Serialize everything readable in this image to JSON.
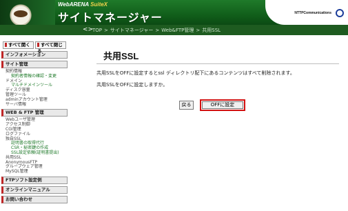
{
  "header": {
    "brand": "WebARENA",
    "suite": "SuiteX",
    "title": "サイトマネージャー",
    "company": "NTTPCommunications"
  },
  "breadcrumb": {
    "arrows": "<>",
    "items": [
      "TOP",
      "サイトマネージャー",
      "Web&FTP管理",
      "共用SSL"
    ]
  },
  "sidebar": {
    "open_all": "すべて開く",
    "close_all": "すべて閉じる",
    "info": "インフォメーション",
    "site_admin": "サイト管理",
    "site_items": [
      "契約情報",
      "契約者情報の確認・変更",
      "ドメイン",
      "マルチドメインツール",
      "ディスク容量",
      "管理ツール",
      "adminアカウント管理",
      "サーバ情報"
    ],
    "webftp": "WEB & FTP 管理",
    "webftp_items": [
      "Webユーザ管理",
      "アクセス制御",
      "CGI管理",
      "ログファイル",
      "独自SSL",
      "証明書の取得代行",
      "CSR・秘密鍵の作成",
      "SSL設定依頼(証明書提出)",
      "共用SSL",
      "AnonymousFTP",
      "グループウェア管理",
      "MySQL管理"
    ],
    "ftp_settings": "FTPソフト設定例",
    "online_manual": "オンラインマニュアル",
    "contact": "お問い合わせ"
  },
  "main": {
    "title": "共用SSL",
    "message1": "共用SSLをOFFに設定するとssl ディレクトリ配下にあるコンテンツはすべて削除されます。",
    "message2": "共用SSLをOFFに設定しますか。",
    "back_label": "戻る",
    "off_label": "OFFに設定"
  }
}
